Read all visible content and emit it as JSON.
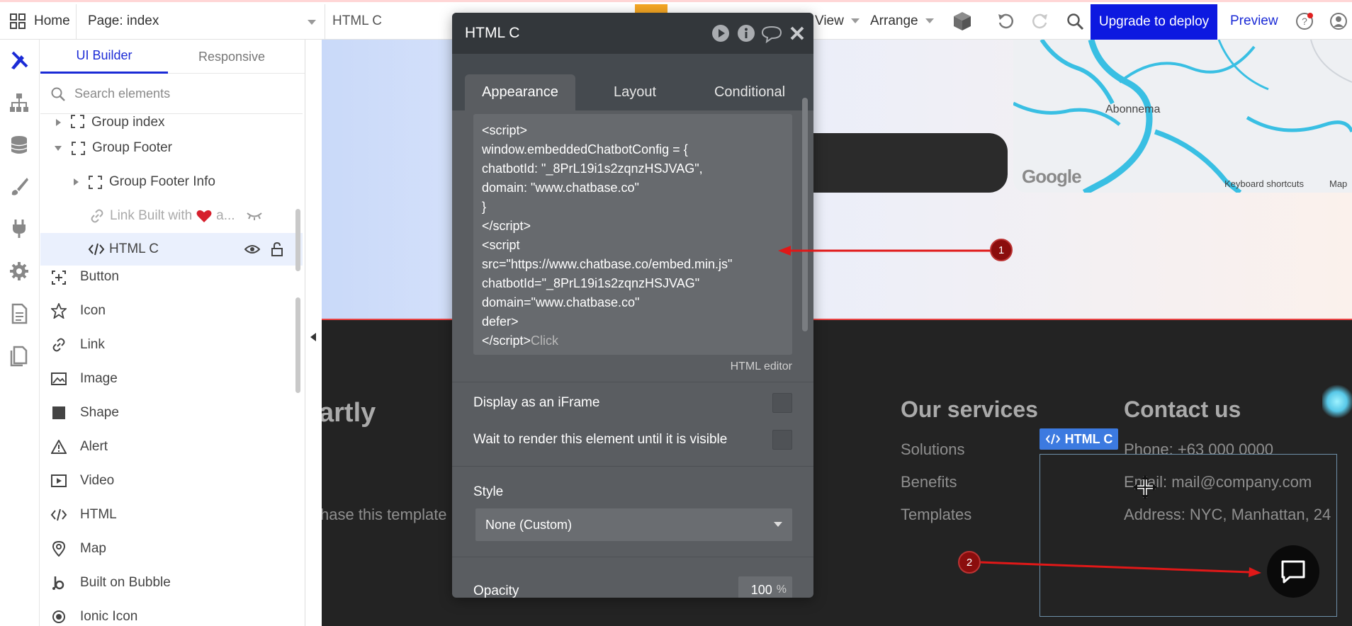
{
  "topbar": {
    "home_label": "Home",
    "page_label": "Page: index",
    "element_label": "HTML C",
    "view_label": "View",
    "arrange_label": "Arrange",
    "upgrade_label": "Upgrade to deploy",
    "preview_label": "Preview",
    "upgrade_color": "#0d19e0"
  },
  "left_panel": {
    "tabs": [
      "UI Builder",
      "Responsive"
    ],
    "search_placeholder": "Search elements",
    "tree": [
      {
        "label": "Group index"
      },
      {
        "label": "Group Footer"
      },
      {
        "label": "Group Footer Info"
      },
      {
        "label": "Link Built with"
      },
      {
        "label": "a..."
      },
      {
        "label": "HTML C"
      }
    ],
    "elements": [
      {
        "label": "Button",
        "icon": "button-icon"
      },
      {
        "label": "Icon",
        "icon": "star-icon"
      },
      {
        "label": "Link",
        "icon": "link-icon"
      },
      {
        "label": "Image",
        "icon": "image-icon"
      },
      {
        "label": "Shape",
        "icon": "shape-icon"
      },
      {
        "label": "Alert",
        "icon": "alert-icon"
      },
      {
        "label": "Video",
        "icon": "video-icon"
      },
      {
        "label": "HTML",
        "icon": "code-icon"
      },
      {
        "label": "Map",
        "icon": "map-pin-icon"
      },
      {
        "label": "Built on Bubble",
        "icon": "bubble-icon"
      },
      {
        "label": "Ionic Icon",
        "icon": "ionic-icon"
      }
    ]
  },
  "editor": {
    "title": "HTML C",
    "tabs": [
      "Appearance",
      "Layout",
      "Conditional"
    ],
    "code_lines": [
      "<script>",
      "window.embeddedChatbotConfig = {",
      "chatbotId: \"_8PrL19i1s2zqnzHSJVAG\",",
      "domain: \"www.chatbase.co\"",
      "}",
      "</scr",
      "<script",
      "src=\"https://www.chatbase.co/embed.min.js\"",
      "chatbotId=\"_8PrL19i1s2zqnzHSJVAG\"",
      "domain=\"www.chatbase.co\"",
      "defer>",
      "</scr"
    ],
    "code_tail": "Click",
    "hint": "HTML editor",
    "iframe_label": "Display as an iFrame",
    "wait_label": "Wait to render this element until it is visible",
    "style_label": "Style",
    "style_value": "None (Custom)",
    "opacity_label": "Opacity",
    "opacity_value": "100",
    "opacity_unit": "%"
  },
  "canvas": {
    "map_town": "Abonnema",
    "map_shortcuts": "Keyboard shortcuts",
    "map_data": "Map",
    "google_logo": "Google",
    "footer_heading_left": "artly",
    "footer_text_left": "hase this template",
    "services_heading": "Our services",
    "services": [
      "Solutions",
      "Benefits",
      "Templates"
    ],
    "contact_heading": "Contact us",
    "contact": [
      "Phone: +63 000 0000",
      "Email: mail@company.com",
      "Address: NYC, Manhattan, 24"
    ],
    "html_badge": "HTML C"
  },
  "annotations": [
    "1",
    "2"
  ]
}
